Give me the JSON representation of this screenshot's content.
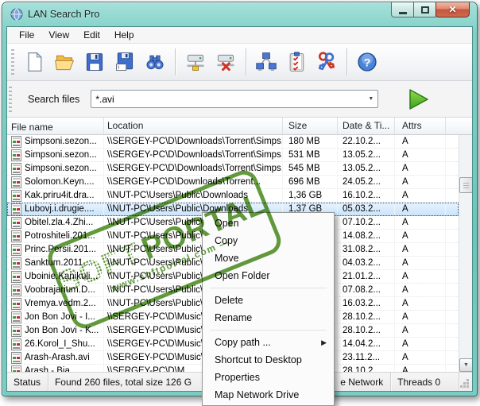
{
  "window": {
    "title": "LAN Search Pro"
  },
  "icons": {
    "close": "✕",
    "dropdown": "▼",
    "scroll_up": "▲",
    "scroll_down": "▼",
    "submenu_arrow": "▶",
    "help_question": "?"
  },
  "menu_bar": {
    "items": [
      "File",
      "View",
      "Edit",
      "Help"
    ]
  },
  "toolbar": {
    "buttons": [
      "new-file",
      "open-folder",
      "save",
      "save-as",
      "find",
      "map-network-drive",
      "disconnect-network-drive",
      "network-computers",
      "scan-checklist",
      "permissions-keys",
      "help"
    ]
  },
  "search": {
    "label": "Search files",
    "value": "*.avi"
  },
  "table": {
    "columns": [
      "File name",
      "Location",
      "Size",
      "Date & Ti...",
      "Attrs"
    ],
    "rows": [
      {
        "name": "Simpsoni.sezon...",
        "location": "\\\\SERGEY-PC\\D\\Downloads\\Torrent\\Simps...",
        "size": "180 MB",
        "date": "22.10.2...",
        "attrs": "A",
        "selected": false
      },
      {
        "name": "Simpsoni.sezon...",
        "location": "\\\\SERGEY-PC\\D\\Downloads\\Torrent\\Simps...",
        "size": "531 MB",
        "date": "13.05.2...",
        "attrs": "A",
        "selected": false
      },
      {
        "name": "Simpsoni.sezon...",
        "location": "\\\\SERGEY-PC\\D\\Downloads\\Torrent\\Simps...",
        "size": "545 MB",
        "date": "13.05.2...",
        "attrs": "A",
        "selected": false
      },
      {
        "name": "Solomon.Keyn....",
        "location": "\\\\SERGEY-PC\\D\\Downloads\\Torrent...",
        "size": "696 MB",
        "date": "24.05.2...",
        "attrs": "A",
        "selected": false
      },
      {
        "name": "Kak.priru4it.dra...",
        "location": "\\\\NUT-PC\\Users\\Public\\Downloads",
        "size": "1,36 GB",
        "date": "16.10.2...",
        "attrs": "A",
        "selected": false
      },
      {
        "name": "Lubovj.i.drugie....",
        "location": "\\\\NUT-PC\\Users\\Public\\Downloads",
        "size": "1,37 GB",
        "date": "05.03.2...",
        "attrs": "A",
        "selected": true
      },
      {
        "name": "Obitel.zla.4.Zhi...",
        "location": "\\\\NUT-PC\\Users\\Public\\Downloads",
        "size": "",
        "date": "07.10.2...",
        "attrs": "A",
        "selected": false
      },
      {
        "name": "Potroshiteli.201...",
        "location": "\\\\NUT-PC\\Users\\Public\\Downloads",
        "size": "",
        "date": "14.08.2...",
        "attrs": "A",
        "selected": false
      },
      {
        "name": "Princ.Persii.201...",
        "location": "\\\\NUT-PC\\Users\\Public\\Downloads",
        "size": "",
        "date": "31.08.2...",
        "attrs": "A",
        "selected": false
      },
      {
        "name": "Sanktum.2011....",
        "location": "\\\\NUT-PC\\Users\\Public\\Downloads",
        "size": "",
        "date": "04.03.2...",
        "attrs": "A",
        "selected": false
      },
      {
        "name": "Uboinie.Kanikuli...",
        "location": "\\\\NUT-PC\\Users\\Public\\Downloads",
        "size": "",
        "date": "21.01.2...",
        "attrs": "A",
        "selected": false
      },
      {
        "name": "Voobrajarium.D...",
        "location": "\\\\NUT-PC\\Users\\Public\\Downloads",
        "size": "",
        "date": "07.08.2...",
        "attrs": "A",
        "selected": false
      },
      {
        "name": "Vremya.vedm.2...",
        "location": "\\\\NUT-PC\\Users\\Public\\Downloads",
        "size": "",
        "date": "16.03.2...",
        "attrs": "A",
        "selected": false
      },
      {
        "name": "Jon Bon Jovi - I...",
        "location": "\\\\SERGEY-PC\\D\\Music\\...",
        "size": "",
        "date": "28.10.2...",
        "attrs": "A",
        "selected": false
      },
      {
        "name": "Jon Bon Jovi - K...",
        "location": "\\\\SERGEY-PC\\D\\Music\\...",
        "size": "",
        "date": "28.10.2...",
        "attrs": "A",
        "selected": false
      },
      {
        "name": "26.Korol_I_Shu...",
        "location": "\\\\SERGEY-PC\\D\\Music\\...",
        "size": "",
        "date": "14.04.2...",
        "attrs": "A",
        "selected": false
      },
      {
        "name": "Arash-Arash.avi",
        "location": "\\\\SERGEY-PC\\D\\Music\\...",
        "size": "",
        "date": "23.11.2...",
        "attrs": "A",
        "selected": false
      },
      {
        "name": "Arash - Bia...",
        "location": "\\\\SERGEY-PC\\D\\M...",
        "size": "",
        "date": "28.10.2",
        "attrs": "A",
        "selected": false
      }
    ]
  },
  "context_menu": {
    "items": [
      {
        "label": "Open"
      },
      {
        "label": "Copy"
      },
      {
        "label": "Move"
      },
      {
        "label": "Open Folder"
      },
      {
        "type": "separator"
      },
      {
        "label": "Delete"
      },
      {
        "label": "Rename"
      },
      {
        "type": "separator"
      },
      {
        "label": "Copy path ...",
        "submenu": true
      },
      {
        "label": "Shortcut to Desktop"
      },
      {
        "label": "Properties"
      },
      {
        "label": "Map Network Drive"
      }
    ]
  },
  "stamp": {
    "word1": "SOFT",
    "word2": "PORTAL",
    "url": "www.softportal.com —",
    "color": "#4a8c1f"
  },
  "status_bar": {
    "label": "Status",
    "message": "Found 260 files, total size 126 G",
    "network": "e Network",
    "threads": "Threads 0"
  },
  "colors": {
    "frame_teal": "#6cc6bd",
    "close_button": "#cf6a4e",
    "selection": "#cbe4fb",
    "start_button": "#4db528",
    "stamp_green": "#4a8c1f"
  }
}
